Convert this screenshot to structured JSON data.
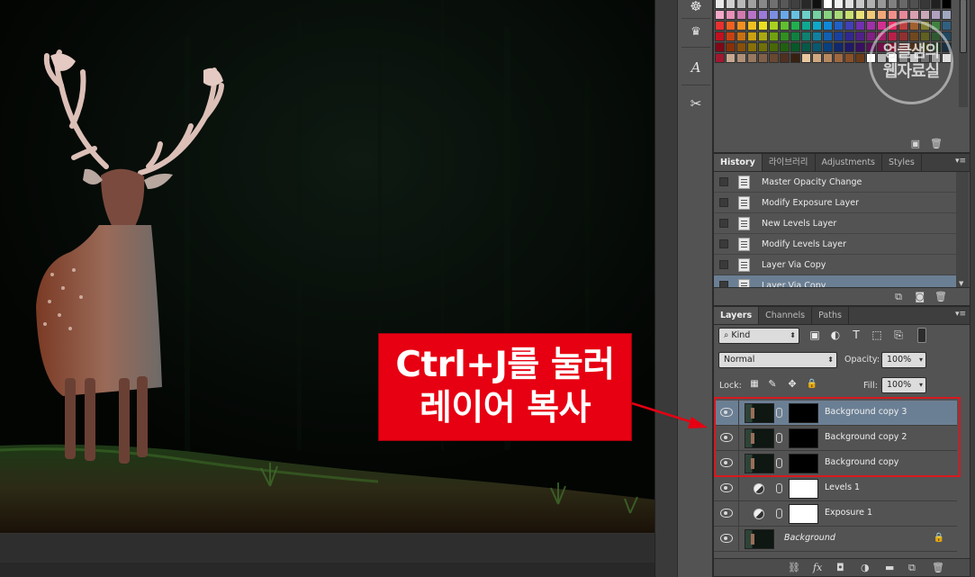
{
  "swatches": {
    "rows": [
      [
        "#e8e8e8",
        "#d0d0d0",
        "#b8b8b8",
        "#a0a0a0",
        "#888888",
        "#707070",
        "#585858",
        "#404040",
        "#282828",
        "#101010",
        "#ffffff",
        "#f0f0f0",
        "#e0e0e0",
        "#c8c8c8",
        "#b0b0b0",
        "#989898",
        "#808080",
        "#686868",
        "#505050",
        "#383838",
        "#202020",
        "#000000"
      ],
      [
        "#f4a8c8",
        "#e890b8",
        "#d07ab0",
        "#b872c8",
        "#9c7ad8",
        "#7c8ee0",
        "#6aa8e8",
        "#68c0e0",
        "#6cd0c8",
        "#74d0a0",
        "#88d080",
        "#a8d878",
        "#c8e070",
        "#e8e078",
        "#f0c878",
        "#f0a878",
        "#f09088",
        "#e88898",
        "#d8a0b0",
        "#c8a8b8",
        "#b0a0c0",
        "#a0a8c0"
      ],
      [
        "#e83030",
        "#f06020",
        "#f09020",
        "#f0c020",
        "#e8e020",
        "#a8d020",
        "#60c030",
        "#20b050",
        "#10a890",
        "#10a8c8",
        "#1088d8",
        "#2060c8",
        "#4040b8",
        "#7030b0",
        "#a030a8",
        "#d03090",
        "#e83068",
        "#c04040",
        "#a06030",
        "#808030",
        "#408040",
        "#306080"
      ],
      [
        "#c01020",
        "#c84010",
        "#c87010",
        "#c8a010",
        "#a8a810",
        "#70a010",
        "#309020",
        "#108040",
        "#108070",
        "#1080a0",
        "#1060b0",
        "#1840a0",
        "#302890",
        "#502088",
        "#802080",
        "#a02068",
        "#b82048",
        "#903030",
        "#704820",
        "#606020",
        "#305830",
        "#204860"
      ],
      [
        "#800818",
        "#883008",
        "#885008",
        "#887008",
        "#707008",
        "#486808",
        "#206010",
        "#085828",
        "#085848",
        "#085870",
        "#084080",
        "#102870",
        "#201868",
        "#381060",
        "#581058",
        "#701048",
        "#801030",
        "#602020",
        "#503018",
        "#404018",
        "#203820",
        "#183040"
      ],
      [
        "#a01830",
        "#c8a890",
        "#b09078",
        "#987860",
        "#806048",
        "#684830",
        "#503020",
        "#382010",
        "#e8c8a0",
        "#d0a880",
        "#b88860",
        "#a06840",
        "#885028",
        "#6c3c18",
        "#ffffff",
        "#b8b8b8",
        "#ffffff",
        "#888888",
        "#c8c8c8",
        "#707070",
        "#a0a0a0",
        "#e0e0e0"
      ]
    ]
  },
  "toolstrip": {
    "tools": [
      {
        "icon": "ship-wheel-icon",
        "glyph": "☸"
      },
      {
        "icon": "brush-preset-icon",
        "glyph": "♛"
      },
      {
        "icon": "character-icon",
        "glyph": "A"
      },
      {
        "icon": "tool-presets-icon",
        "glyph": "✂"
      }
    ]
  },
  "history": {
    "tabs": [
      "History",
      "라이브러리",
      "Adjustments",
      "Styles"
    ],
    "items": [
      {
        "label": "Master Opacity Change",
        "selected": false
      },
      {
        "label": "Modify Exposure Layer",
        "selected": false
      },
      {
        "label": "New Levels Layer",
        "selected": false
      },
      {
        "label": "Modify Levels Layer",
        "selected": false
      },
      {
        "label": "Layer Via Copy",
        "selected": false
      },
      {
        "label": "Layer Via Copy",
        "selected": true
      }
    ]
  },
  "layers": {
    "tabs": [
      "Layers",
      "Channels",
      "Paths"
    ],
    "filter_label": "Kind",
    "blend_mode": "Normal",
    "opacity_label": "Opacity:",
    "opacity_value": "100%",
    "lock_label": "Lock:",
    "fill_label": "Fill:",
    "fill_value": "100%",
    "items": [
      {
        "name": "Background copy 3",
        "kind": "image-mask",
        "selected": true
      },
      {
        "name": "Background copy 2",
        "kind": "image-mask",
        "selected": false
      },
      {
        "name": "Background copy",
        "kind": "image-mask",
        "selected": false
      },
      {
        "name": "Levels 1",
        "kind": "adjustment",
        "selected": false
      },
      {
        "name": "Exposure 1",
        "kind": "adjustment",
        "selected": false
      },
      {
        "name": "Background",
        "kind": "background",
        "selected": false
      }
    ]
  },
  "callout": {
    "line1": "Ctrl+J를 눌러",
    "line2": "레이어 복사",
    "color": "#e60012"
  },
  "watermark": {
    "line1": "엉클샘의",
    "line2": "웹자료실"
  },
  "colors": {
    "panel_bg": "#535353",
    "selection": "#6b7f94",
    "highlight_border": "#d8181e"
  }
}
